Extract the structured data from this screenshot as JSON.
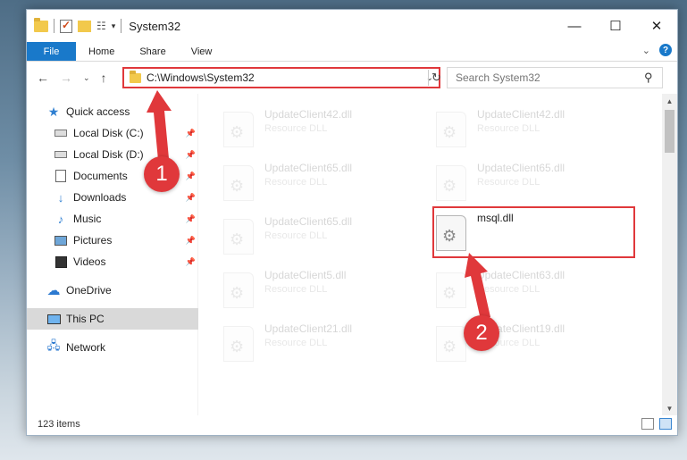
{
  "window": {
    "title": "System32",
    "controls": {
      "minimize": "—",
      "maximize": "☐",
      "close": "✕"
    }
  },
  "ribbon": {
    "tabs": [
      "File",
      "Home",
      "Share",
      "View"
    ],
    "collapse_chevron": "⌄",
    "help": "?"
  },
  "navigation": {
    "back": "←",
    "forward": "→",
    "recent": "⌄",
    "up": "↑"
  },
  "address": {
    "path": "C:\\Windows\\System32",
    "dropdown": "⌄",
    "refresh": "↻"
  },
  "search": {
    "placeholder": "Search System32",
    "icon": "search-icon"
  },
  "sidebar": {
    "items": [
      {
        "label": "Quick access",
        "icon": "star-icon",
        "pinned": false
      },
      {
        "label": "Local Disk (C:)",
        "icon": "drive-icon",
        "pinned": true
      },
      {
        "label": "Local Disk (D:)",
        "icon": "drive-icon",
        "pinned": true
      },
      {
        "label": "Documents",
        "icon": "documents-icon",
        "pinned": true
      },
      {
        "label": "Downloads",
        "icon": "download-icon",
        "pinned": true
      },
      {
        "label": "Music",
        "icon": "music-icon",
        "pinned": true
      },
      {
        "label": "Pictures",
        "icon": "pictures-icon",
        "pinned": true
      },
      {
        "label": "Videos",
        "icon": "videos-icon",
        "pinned": true
      },
      {
        "label": "OneDrive",
        "icon": "cloud-icon",
        "pinned": false
      },
      {
        "label": "This PC",
        "icon": "computer-icon",
        "pinned": false,
        "selected": true
      },
      {
        "label": "Network",
        "icon": "network-icon",
        "pinned": false
      }
    ]
  },
  "files": [
    {
      "name": "UpdateClient42.dll",
      "type": "Resource DLL",
      "faded": true
    },
    {
      "name": "UpdateClient42.dll",
      "type": "Resource DLL",
      "faded": true
    },
    {
      "name": "UpdateClient65.dll",
      "type": "Resource DLL",
      "faded": true
    },
    {
      "name": "UpdateClient65.dll",
      "type": "Resource DLL",
      "faded": true
    },
    {
      "name": "UpdateClient65.dll",
      "type": "Resource DLL",
      "faded": true
    },
    {
      "name": "msql.dll",
      "type": "",
      "faded": false,
      "highlighted": true
    },
    {
      "name": "UpdateClient5.dll",
      "type": "Resource DLL",
      "faded": true
    },
    {
      "name": "UpdateClient63.dll",
      "type": "Resource DLL",
      "faded": true
    },
    {
      "name": "UpdateClient21.dll",
      "type": "Resource DLL",
      "faded": true
    },
    {
      "name": "UpdateClient19.dll",
      "type": "Resource DLL",
      "faded": true
    }
  ],
  "status": {
    "item_count": "123 items"
  },
  "annotations": {
    "step1": "1",
    "step2": "2",
    "color": "#e0383b"
  }
}
